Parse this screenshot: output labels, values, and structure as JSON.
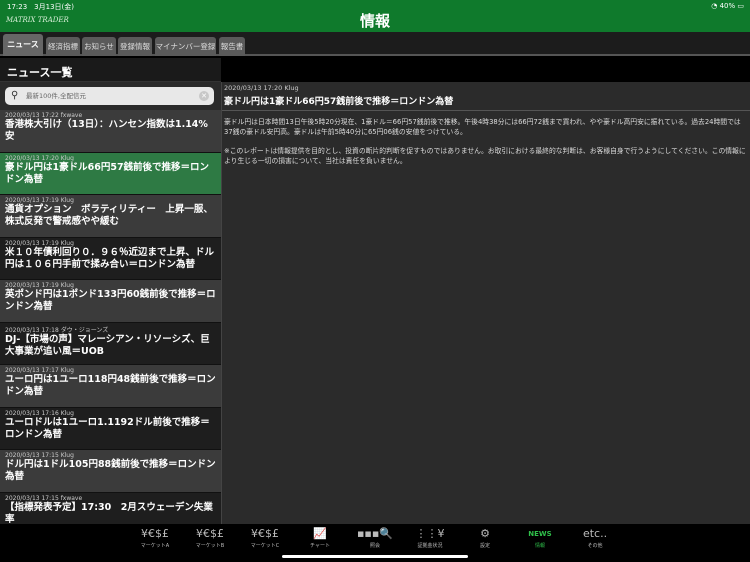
{
  "status": {
    "time": "17:23　3月13日(金)",
    "battery": "40%"
  },
  "app": {
    "logo": "MATRIX TRADER",
    "title": "情報"
  },
  "tabs": [
    "ニュース",
    "経済指標",
    "お知らせ",
    "登録情報",
    "マイナンバー登録",
    "報告書"
  ],
  "list": {
    "title": "ニュース一覧",
    "search_placeholder": "最新100件,全配信元",
    "items": [
      {
        "meta": "2020/03/13 17:22 fxwave",
        "headline": "香港株大引け（13日）：ハンセン指数は1.14%安"
      },
      {
        "meta": "2020/03/13 17:20 Klug",
        "headline": "豪ドル円は1豪ドル66円57銭前後で推移＝ロンドン為替"
      },
      {
        "meta": "2020/03/13 17:19 Klug",
        "headline": "通貨オプション　ボラティリティー　上昇一服、株式反発で警戒感やや緩む"
      },
      {
        "meta": "2020/03/13 17:19 Klug",
        "headline": "米１０年債利回り０．９６％近辺まで上昇、ドル円は１０６円手前で揉み合い＝ロンドン為替"
      },
      {
        "meta": "2020/03/13 17:19 Klug",
        "headline": "英ポンド円は1ポンド133円60銭前後で推移＝ロンドン為替"
      },
      {
        "meta": "2020/03/13 17:18 ダウ・ジョーンズ",
        "headline": "DJ-【市場の声】マレーシアン・リソーシズ、巨大事業が追い風＝UOB"
      },
      {
        "meta": "2020/03/13 17:17 Klug",
        "headline": "ユーロ円は1ユーロ118円48銭前後で推移＝ロンドン為替"
      },
      {
        "meta": "2020/03/13 17:16 Klug",
        "headline": "ユーロドルは1ユーロ1.1192ドル前後で推移＝ロンドン為替"
      },
      {
        "meta": "2020/03/13 17:15 Klug",
        "headline": "ドル円は1ドル105円88銭前後で推移＝ロンドン為替"
      },
      {
        "meta": "2020/03/13 17:15 fxwave",
        "headline": "【指標発表予定】17:30　2月スウェーデン失業率"
      }
    ]
  },
  "detail": {
    "meta": "2020/03/13 17:20 Klug",
    "title": "豪ドル円は1豪ドル66円57銭前後で推移＝ロンドン為替",
    "body": "豪ドル円は日本時間13日午後5時20分現在、1豪ドル＝66円57銭前後で推移。午後4時38分には66円72銭まで買われ、やや豪ドル高円安に振れている。過去24時間では37銭の豪ドル安円高。豪ドルは午前5時40分に65円06銭の安値をつけている。",
    "disclaimer": "※このレポートは情報提供を目的とし、投資の断片的判断を促すものではありません。お取引における最終的な判断は、お客様自身で行うようにしてください。この情報により生じる一切の損害について、当社は責任を負いません。"
  },
  "bottom": [
    {
      "icon": "¥€$£",
      "label": "マーケットA"
    },
    {
      "icon": "¥€$£",
      "label": "マーケットB"
    },
    {
      "icon": "¥€$£",
      "label": "マーケットC"
    },
    {
      "icon": "📈",
      "label": "チャート"
    },
    {
      "icon": "▪▪▪🔍",
      "label": "照会"
    },
    {
      "icon": "⋮⋮¥",
      "label": "証拠金状況"
    },
    {
      "icon": "⚙",
      "label": "設定"
    },
    {
      "icon": "NEWS",
      "label": "情報"
    },
    {
      "icon": "etc..",
      "label": "その他"
    }
  ]
}
